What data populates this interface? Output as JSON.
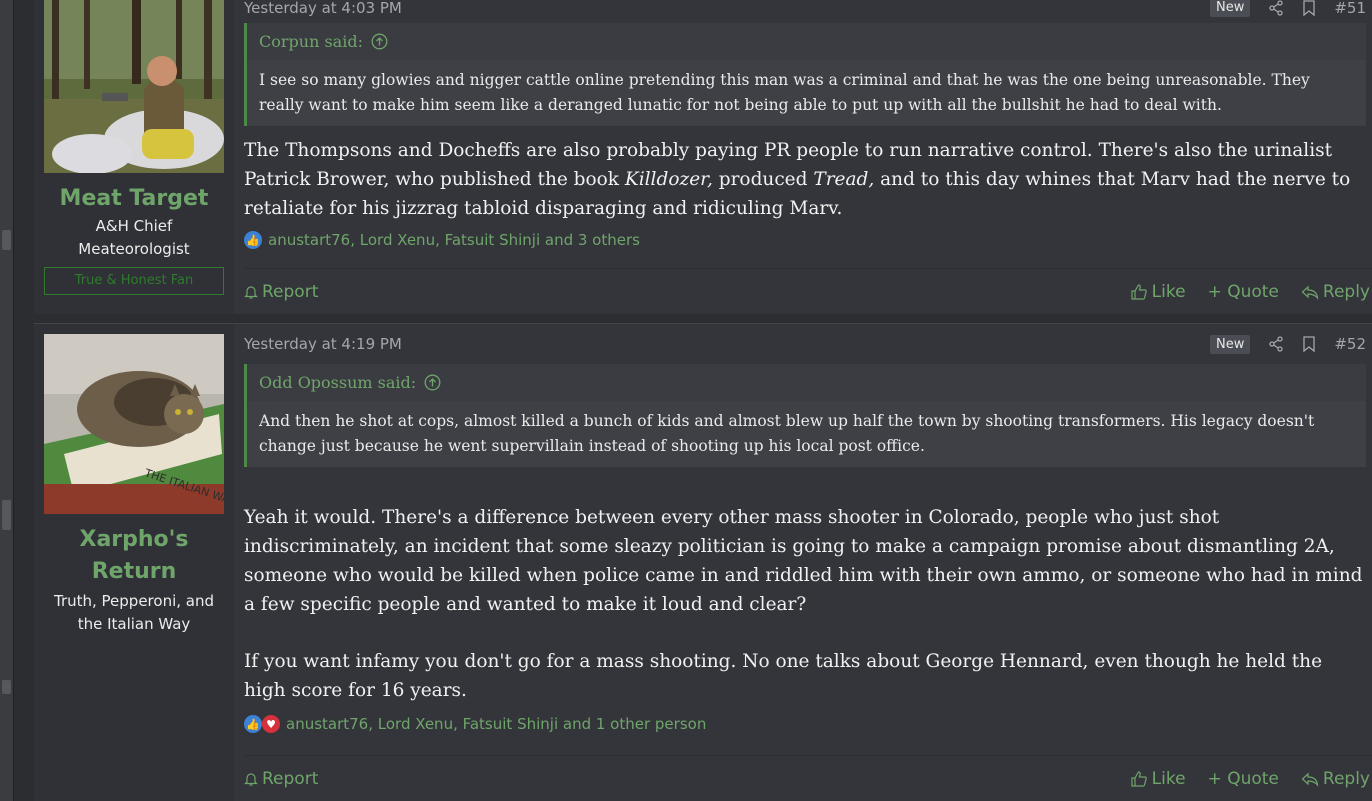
{
  "posts": [
    {
      "timestamp": "Yesterday at 4:03 PM",
      "badge": "New",
      "post_number": "#51",
      "user": {
        "name": "Meat Target",
        "title_line1": "A&H Chief",
        "title_line2": "Meateorologist",
        "banner": "True & Honest Fan"
      },
      "quote": {
        "author": "Corpun said:",
        "text": "I see so many glowies and nigger cattle online pretending this man was a criminal and that he was the one being unreasonable. They really want to make him seem like a deranged lunatic for not being able to put up with all the bullshit he had to deal with."
      },
      "body": {
        "p1_a": "The Thompsons and Docheffs are also probably paying PR people to run narrative control. There's also the urinalist Patrick Brower, who published the book ",
        "p1_book1": "Killdozer,",
        "p1_b": " produced ",
        "p1_book2": "Tread,",
        "p1_c": " and to this day whines that Marv had the nerve to retaliate for his jizzrag tabloid disparaging and ridiculing Marv."
      },
      "reactions": "anustart76, Lord Xenu, Fatsuit Shinji and 3 others",
      "footer": {
        "report": "Report",
        "like": "Like",
        "quote": "+ Quote",
        "reply": "Reply"
      }
    },
    {
      "timestamp": "Yesterday at 4:19 PM",
      "badge": "New",
      "post_number": "#52",
      "user": {
        "name_line1": "Xarpho's",
        "name_line2": "Return",
        "title_line1": "Truth, Pepperoni, and",
        "title_line2": "the Italian Way",
        "avatar_caption": "THE ITALIAN WAY"
      },
      "quote": {
        "author": "Odd Opossum said:",
        "text": "And then he shot at cops, almost killed a bunch of kids and almost blew up half the town by shooting transformers. His legacy doesn't change just because he went supervillain instead of shooting up his local post office."
      },
      "body": {
        "p1": "Yeah it would. There's a difference between every other mass shooter in Colorado, people who just shot indiscriminately, an incident that some sleazy politician is going to make a campaign promise about dismantling 2A, someone who would be killed when police came in and riddled him with their own ammo, or someone who had in mind a few specific people and wanted to make it loud and clear?",
        "p2": "If you want infamy you don't go for a mass shooting. No one talks about George Hennard, even though he held the high score for 16 years."
      },
      "reactions": "anustart76, Lord Xenu, Fatsuit Shinji and 1 other person",
      "footer": {
        "report": "Report",
        "like": "Like",
        "quote": "+ Quote",
        "reply": "Reply"
      }
    }
  ],
  "colors": {
    "accent_green": "#6fa56a",
    "background": "#2b2d31",
    "post_bg": "#33353b"
  },
  "icons": [
    "share-icon",
    "bookmark-icon",
    "arrow-up-circle-icon",
    "bell-icon",
    "thumbs-up-icon",
    "reply-icon"
  ]
}
